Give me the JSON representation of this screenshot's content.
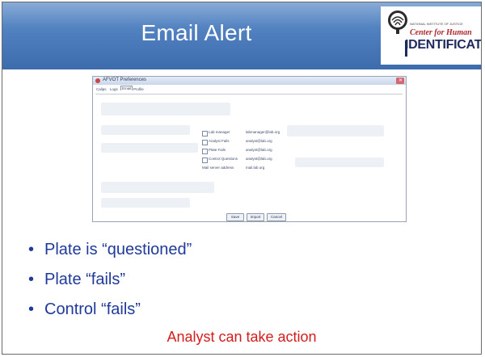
{
  "slide": {
    "title": "Email Alert",
    "logo": {
      "small_text": "NATIONAL INSTITUTE OF JUSTICE",
      "line1": "Center for Human",
      "line2": "IDENTIFICATION"
    },
    "bullets": [
      "Plate is “questioned”",
      "Plate “fails”",
      "Control “fails”"
    ],
    "note": "Analyst can take action",
    "colors": {
      "banner": "#4f7fbe",
      "bullet_text": "#1f3a9a",
      "note_text": "#d41c1c"
    }
  },
  "dialog": {
    "title": "AFVOT Preferences",
    "tabs": [
      "Calips",
      "Logs",
      "Email",
      "Profile"
    ],
    "active_tab": "Email",
    "options": [
      {
        "label": "Lab manager",
        "value": "labmanager@lab.org",
        "checked": false
      },
      {
        "label": "Analyst Fails",
        "value": "analyst@lab.org",
        "checked": false
      },
      {
        "label": "Plate Fails",
        "value": "analyst@lab.org",
        "checked": false
      },
      {
        "label": "Control Questions",
        "value": "analyst@lab.org",
        "checked": false
      },
      {
        "label": "Mail server address",
        "value": "mail.lab.org",
        "checked": false
      }
    ],
    "buttons": {
      "save": "Save",
      "import": "Import",
      "cancel": "Cancel"
    }
  }
}
